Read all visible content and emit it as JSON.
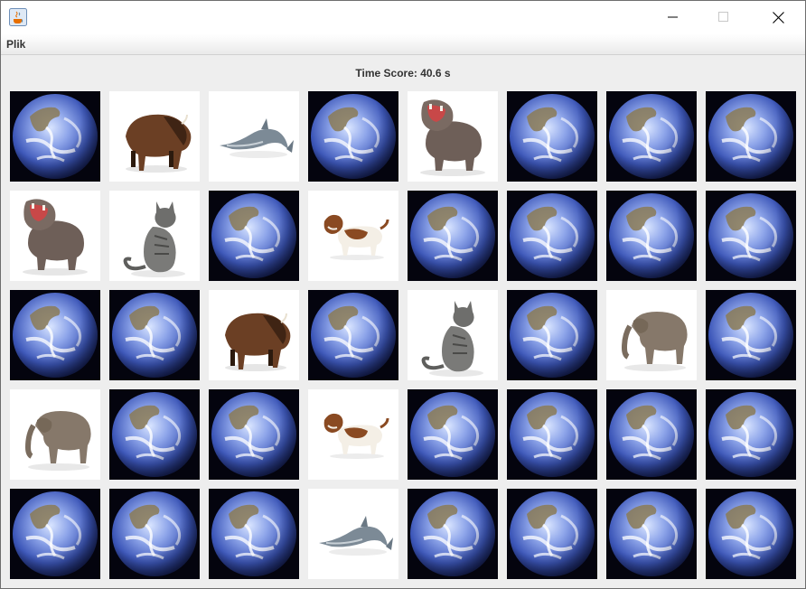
{
  "window": {
    "title": ""
  },
  "menu": {
    "items": [
      {
        "label": "Plik"
      }
    ]
  },
  "score": {
    "label": "Time Score: 40.6 s"
  },
  "board": {
    "rows": 5,
    "cols": 8,
    "cards": [
      "earth",
      "bison",
      "dolphin",
      "earth",
      "hippo",
      "earth",
      "earth",
      "earth",
      "hippo",
      "cat",
      "earth",
      "dog",
      "earth",
      "earth",
      "earth",
      "earth",
      "earth",
      "earth",
      "bison",
      "earth",
      "cat",
      "earth",
      "elephant",
      "earth",
      "elephant",
      "earth",
      "earth",
      "dog",
      "earth",
      "earth",
      "earth",
      "earth",
      "earth",
      "earth",
      "earth",
      "dolphin",
      "earth",
      "earth",
      "earth",
      "earth"
    ]
  }
}
